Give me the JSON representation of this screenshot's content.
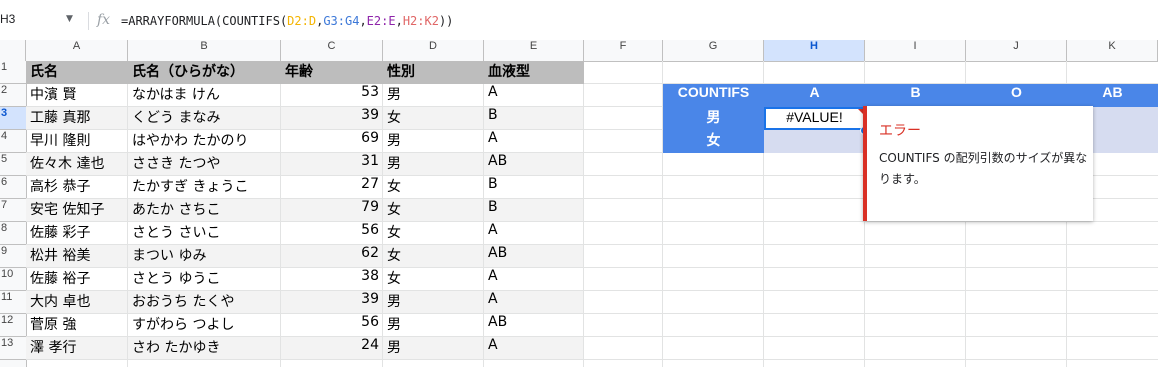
{
  "formula_bar": {
    "name_box": "H3",
    "fx": "fx",
    "formula_parts": [
      "=ARRAYFORMULA(COUNTIFS(",
      "D2:D",
      ",",
      "G3:G4",
      ",",
      "E2:E",
      ",",
      "H2:K2",
      "))"
    ]
  },
  "columns": [
    "A",
    "B",
    "C",
    "D",
    "E",
    "F",
    "G",
    "H",
    "I",
    "J",
    "K"
  ],
  "rows": [
    "1",
    "2",
    "3",
    "4",
    "5",
    "6",
    "7",
    "8",
    "9",
    "10",
    "11",
    "12",
    "13"
  ],
  "table": {
    "headers": [
      "氏名",
      "氏名（ひらがな）",
      "年齢",
      "性別",
      "血液型"
    ],
    "rows": [
      [
        "中濱 賢",
        "なかはま けん",
        "53",
        "男",
        "A"
      ],
      [
        "工藤 真那",
        "くどう まなみ",
        "39",
        "女",
        "B"
      ],
      [
        "早川 隆則",
        "はやかわ たかのり",
        "69",
        "男",
        "A"
      ],
      [
        "佐々木 達也",
        "ささき たつや",
        "31",
        "男",
        "AB"
      ],
      [
        "高杉 恭子",
        "たかすぎ きょうこ",
        "27",
        "女",
        "B"
      ],
      [
        "安宅 佐知子",
        "あたか さちこ",
        "79",
        "女",
        "B"
      ],
      [
        "佐藤 彩子",
        "さとう さいこ",
        "56",
        "女",
        "A"
      ],
      [
        "松井 裕美",
        "まつい ゆみ",
        "62",
        "女",
        "AB"
      ],
      [
        "佐藤 裕子",
        "さとう ゆうこ",
        "38",
        "女",
        "A"
      ],
      [
        "大内 卓也",
        "おおうち たくや",
        "39",
        "男",
        "A"
      ],
      [
        "菅原 強",
        "すがわら つよし",
        "56",
        "男",
        "AB"
      ],
      [
        "澤 孝行",
        "さわ たかゆき",
        "24",
        "男",
        "A"
      ]
    ]
  },
  "summary": {
    "corner": "COUNTIFS",
    "col_headers": [
      "A",
      "B",
      "O",
      "AB"
    ],
    "row_labels": [
      "男",
      "女"
    ],
    "active_value": "#VALUE!"
  },
  "error_popup": {
    "title": "エラー",
    "message": "COUNTIFS の配列引数のサイズが異なります。"
  }
}
